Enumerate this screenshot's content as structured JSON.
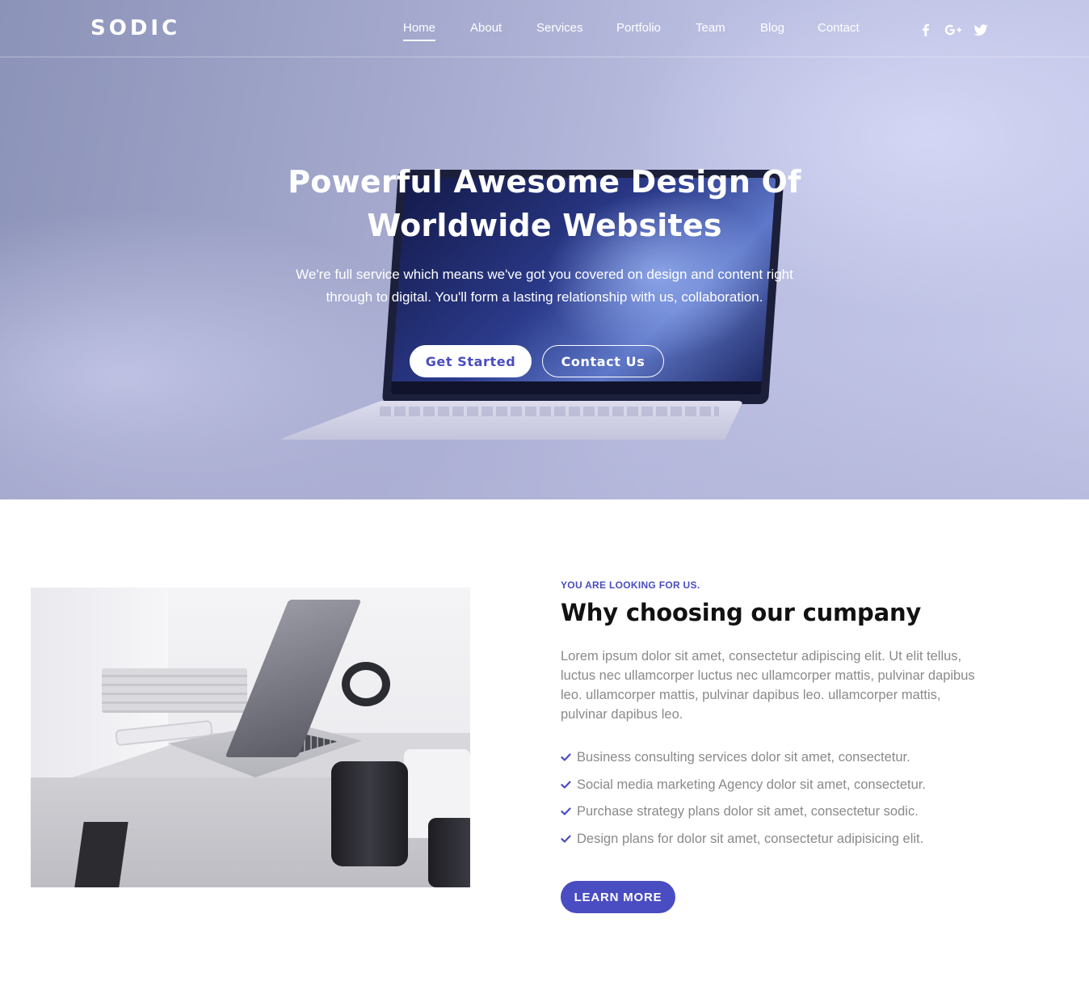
{
  "brand": {
    "logo": "SODIC"
  },
  "nav": {
    "items": [
      {
        "label": "Home",
        "active": true
      },
      {
        "label": "About"
      },
      {
        "label": "Services"
      },
      {
        "label": "Portfolio"
      },
      {
        "label": "Team"
      },
      {
        "label": "Blog"
      },
      {
        "label": "Contact"
      }
    ],
    "social_icons": [
      "facebook-icon",
      "google-plus-icon",
      "twitter-icon"
    ]
  },
  "hero": {
    "title_line1": "Powerful Awesome Design Of",
    "title_line2": "Worldwide Websites",
    "text_line1": "We're full service which means we've got you covered on design and content right",
    "text_line2": "through to digital. You'll form a lasting relationship with us, collaboration.",
    "primary_button": "Get Started",
    "secondary_button": "Contact Us"
  },
  "about": {
    "eyebrow": "YOU ARE LOOKING FOR US.",
    "title": "Why choosing our cumpany",
    "paragraph": "Lorem ipsum dolor sit amet, consectetur adipiscing elit. Ut elit tellus, luctus nec ullamcorper luctus nec ullamcorper mattis, pulvinar dapibus leo. ullamcorper mattis, pulvinar dapibus leo. ullamcorper mattis, pulvinar dapibus leo.",
    "features": [
      "Business consulting services dolor sit amet, consectetur.",
      "Social media marketing Agency dolor sit amet, consectetur.",
      "Purchase strategy plans dolor sit amet, consectetur sodic.",
      "Design plans for dolor sit amet, consectetur adipisicing elit."
    ],
    "button": "LEARN MORE"
  },
  "colors": {
    "accent": "#4a4cc1",
    "heading": "#111111",
    "body_text": "#8a8a8a",
    "hero_start": "#8c93b8",
    "hero_end": "#c5c8e9"
  }
}
